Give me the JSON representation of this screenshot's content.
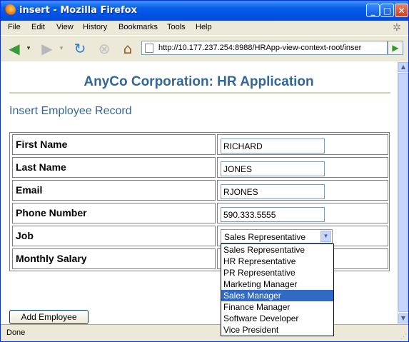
{
  "window": {
    "title": "insert - Mozilla Firefox"
  },
  "menu": [
    "File",
    "Edit",
    "View",
    "History",
    "Bookmarks",
    "Tools",
    "Help"
  ],
  "address": {
    "url": "http://10.177.237.254:8988/HRApp-view-context-root/inser"
  },
  "page": {
    "app_title": "AnyCo Corporation: HR Application",
    "section_title": "Insert Employee Record"
  },
  "form": {
    "first_name_label": "First Name",
    "first_name_value": "RICHARD",
    "last_name_label": "Last Name",
    "last_name_value": "JONES",
    "email_label": "Email",
    "email_value": "RJONES",
    "phone_label": "Phone Number",
    "phone_value": "590.333.5555",
    "job_label": "Job",
    "job_value": "Sales Representative",
    "salary_label": "Monthly Salary"
  },
  "job_options": [
    "Sales Representative",
    "HR Representative",
    "PR Representative",
    "Marketing Manager",
    "Sales Manager",
    "Finance Manager",
    "Software Developer",
    "Vice President"
  ],
  "job_highlighted": "Sales Manager",
  "buttons": {
    "add_employee": "Add Employee"
  },
  "status": {
    "text": "Done"
  },
  "colors": {
    "heading": "#336699",
    "titlebar": "#0054e3",
    "highlight": "#316ac5"
  }
}
